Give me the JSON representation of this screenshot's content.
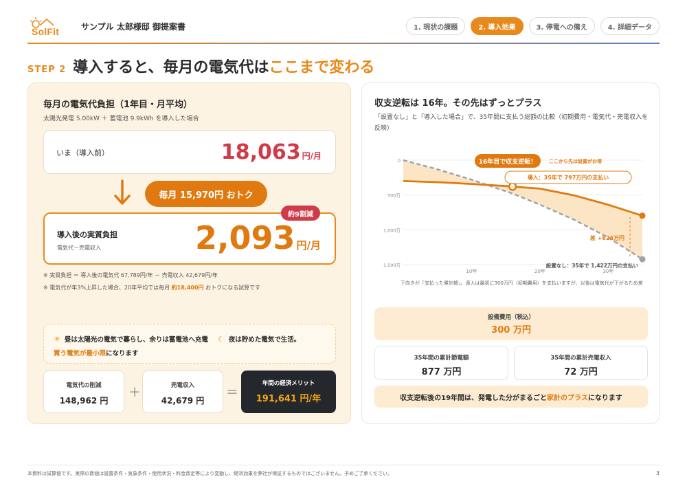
{
  "header": {
    "logo_text": "SolFit",
    "doc_title": "サンプル 太郎様邸 御提案書",
    "steps": [
      "1. 現状の課題",
      "2. 導入効果",
      "3. 停電への備え",
      "4. 詳細データ"
    ],
    "active_step": 1
  },
  "heading": {
    "step_label": "STEP 2",
    "main": "導入すると、毎月の電気代は",
    "accent": "ここまで変わる"
  },
  "left": {
    "title": "毎月の電気代負担（1年目・月平均）",
    "subtitle": "太陽光発電 5.00kW ＋ 蓄電池 9.9kWh を導入した場合",
    "before_label": "いま（導入前）",
    "before_value": "18,063",
    "before_unit": "円/月",
    "savings_pill": "毎月 15,970円 おトク",
    "after_label": "導入後の実質負担",
    "after_sub": "電気代－売電収入",
    "after_value": "2,093",
    "after_unit": "円/月",
    "cut_badge": "約9割減",
    "note1": "※ 実質負担 ＝ 導入後の電気代 67,789円/年 － 売電収入 42,679円/年",
    "note2_pre": "※ 電気代が年3%上昇した場合、20年平均では毎月 ",
    "note2_bold": "約18,400円",
    "note2_post": " おトクになる試算です",
    "tip_day": "昼は太陽光の電気で暮らし、余りは蓄電池へ充電",
    "tip_night": "夜は貯めた電気で生活。",
    "tip_accent": "買う電気が最小限",
    "tip_rest": "になります",
    "cut_label": "電気代の削減",
    "cut_value": "148,962 円",
    "sell_label": "売電収入",
    "sell_value": "42,679 円",
    "plus": "＋",
    "equals": "＝",
    "merit_label": "年間の経済メリット",
    "merit_value": "191,641 円/年"
  },
  "right": {
    "title": "収支逆転は 16年。その先はずっとプラス",
    "subtitle": "「設置なし」と「導入した場合」で、35年間に支払う総額の比較（初期費用・電気代・売電収入を反映）",
    "chart_note": "下向きが「支払った累計額」。導入は最初に300万円（初期費用）を支払いますが、以後は電気代が下がるため差",
    "cost_label": "設備費用（税込）",
    "cost_value": "300 万円",
    "gen_label": "35年間の累計節電額",
    "gen_value": "877 万円",
    "sell_label": "35年間の累計売電収入",
    "sell_value": "72 万円",
    "conclusion_pre": "収支逆転後の19年間は、発電した分がまるごと",
    "conclusion_accent": "家計のプラス",
    "conclusion_post": "になります"
  },
  "chart_data": {
    "type": "line",
    "x": [
      0,
      5,
      10,
      15,
      16,
      20,
      25,
      30,
      35
    ],
    "series": [
      {
        "name": "導入",
        "values": [
          300,
          316,
          341,
          372,
          379,
          409,
          505,
          640,
          797
        ]
      },
      {
        "name": "設置なし",
        "values": [
          0,
          131,
          279,
          446,
          479,
          638,
          855,
          1110,
          1422
        ]
      }
    ],
    "xticks": [
      "10年",
      "20年",
      "30年"
    ],
    "yticks": [
      "0",
      "500万",
      "1,000万",
      "1,500万"
    ],
    "ylim": [
      0,
      1500
    ],
    "xlim": [
      0,
      35
    ],
    "annotations": {
      "crossover": "16年目で収支逆転！",
      "crossover_side": "ここから先は設置がお得",
      "install_end": "導入：35年で 797万円の支払い",
      "none_end": "設置なし：35年で 1,422万円の支払い",
      "diff": "差 +624万円"
    },
    "colors": {
      "install": "#e07a10",
      "none": "#9ea3ab",
      "fill": "#fbdcb0"
    }
  },
  "footer": {
    "note": "本資料は試算値です。実際の数値は設置条件・気象条件・使用状況・料金改定等により変動し、経済効果を弊社が保証するものではございません。予めご了承ください。",
    "page": "3"
  }
}
